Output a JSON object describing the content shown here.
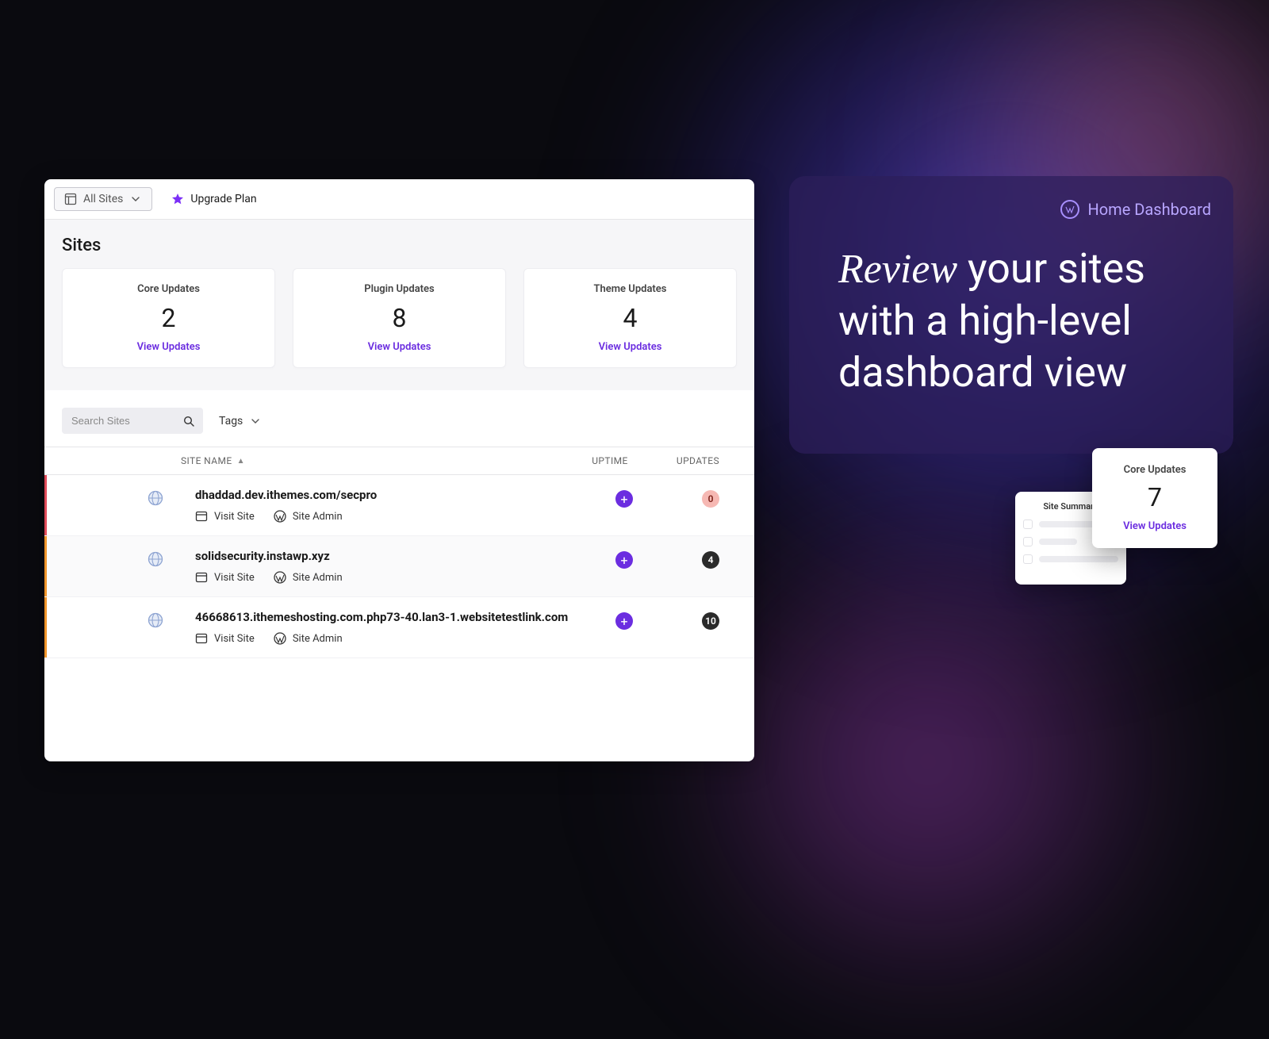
{
  "topbar": {
    "all_sites_label": "All Sites",
    "upgrade_label": "Upgrade Plan"
  },
  "page": {
    "title": "Sites"
  },
  "cards": [
    {
      "title": "Core Updates",
      "count": "2",
      "link": "View Updates"
    },
    {
      "title": "Plugin Updates",
      "count": "8",
      "link": "View Updates"
    },
    {
      "title": "Theme Updates",
      "count": "4",
      "link": "View Updates"
    }
  ],
  "filters": {
    "search_placeholder": "Search Sites",
    "tags_label": "Tags"
  },
  "table": {
    "header": {
      "name": "SITE NAME",
      "uptime": "UPTIME",
      "updates": "UPDATES"
    },
    "visit_label": "Visit Site",
    "admin_label": "Site Admin",
    "rows": [
      {
        "name": "dhaddad.dev.ithemes.com/secpro",
        "bar": "red",
        "updates": "0",
        "updates_style": "red",
        "uptime_badge": "+"
      },
      {
        "name": "solidsecurity.instawp.xyz",
        "bar": "orange",
        "updates": "4",
        "updates_style": "dark",
        "uptime_badge": "+"
      },
      {
        "name": "46668613.ithemeshosting.com.php73-40.lan3-1.websitetestlink.com",
        "bar": "orange",
        "updates": "10",
        "updates_style": "dark",
        "uptime_badge": "+"
      }
    ]
  },
  "promo": {
    "header_label": "Home Dashboard",
    "headline_italic": "Review",
    "headline_rest": " your sites with a high-level dashboard view",
    "float_core": {
      "title": "Core Updates",
      "count": "7",
      "link": "View Updates"
    },
    "float_summary_title": "Site Summary"
  }
}
